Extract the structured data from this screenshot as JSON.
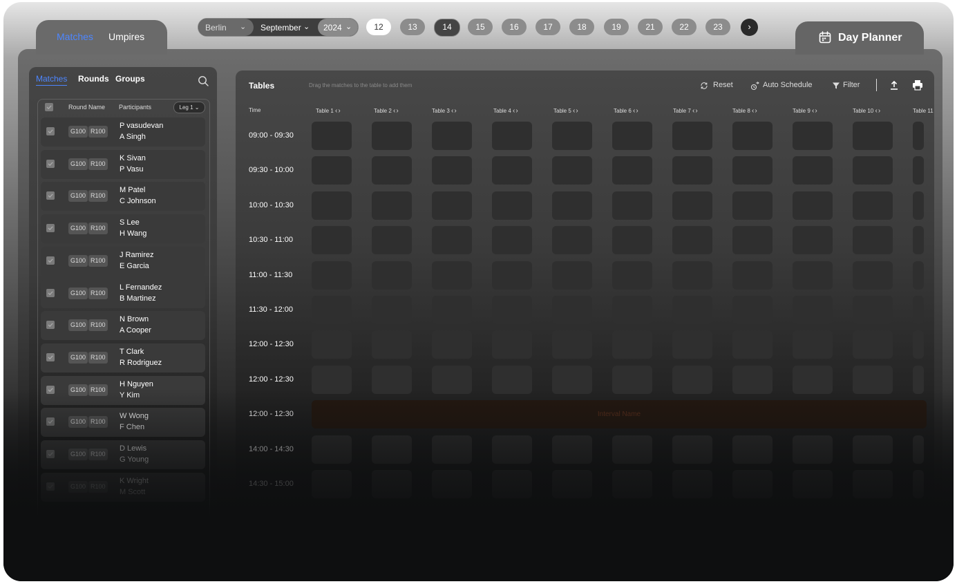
{
  "top_tabs": {
    "matches": "Matches",
    "umpires": "Umpires"
  },
  "day_planner": {
    "title": "Day Planner",
    "icon": "calendar-icon"
  },
  "date_selector": {
    "city": "Berlin",
    "month": "September",
    "year": "2024"
  },
  "dates": [
    "12",
    "13",
    "14",
    "15",
    "16",
    "17",
    "18",
    "19",
    "21",
    "22",
    "23"
  ],
  "selected_date": "12",
  "current_date": "14",
  "accent_color": "#4d86ff",
  "sidebar": {
    "tabs": [
      "Matches",
      "Rounds",
      "Groups"
    ],
    "active_tab": "Matches",
    "list_header": {
      "round": "Round Name",
      "participants": "Participants",
      "leg": "Leg 1"
    },
    "matches": [
      {
        "group": "G100",
        "round": "R100",
        "p1": "P vasudevan",
        "p2": "A Singh"
      },
      {
        "group": "G100",
        "round": "R100",
        "p1": "K Sivan",
        "p2": "P Vasu"
      },
      {
        "group": "G100",
        "round": "R100",
        "p1": "M Patel",
        "p2": "C Johnson"
      },
      {
        "group": "G100",
        "round": "R100",
        "p1": "S Lee",
        "p2": "H Wang"
      },
      {
        "group": "G100",
        "round": "R100",
        "p1": "J Ramirez",
        "p2": "E Garcia"
      },
      {
        "group": "G100",
        "round": "R100",
        "p1": "L Fernandez",
        "p2": "B Martinez"
      },
      {
        "group": "G100",
        "round": "R100",
        "p1": "N Brown",
        "p2": "A Cooper"
      },
      {
        "group": "G100",
        "round": "R100",
        "p1": "T Clark",
        "p2": "R Rodriguez"
      },
      {
        "group": "G100",
        "round": "R100",
        "p1": "H Nguyen",
        "p2": "Y Kim"
      },
      {
        "group": "G100",
        "round": "R100",
        "p1": "W Wong",
        "p2": "F Chen"
      },
      {
        "group": "G100",
        "round": "R100",
        "p1": "D Lewis",
        "p2": "G Young"
      },
      {
        "group": "G100",
        "round": "R100",
        "p1": "K Wright",
        "p2": "M Scott"
      }
    ]
  },
  "tables_panel": {
    "title": "Tables",
    "hint": "Drag the matches to the table to add them",
    "reset": "Reset",
    "auto_schedule": "Auto Schedule",
    "filter": "Filter",
    "time_label": "Time",
    "tables": [
      "Table 1",
      "Table 2",
      "Table 3",
      "Table 4",
      "Table 5",
      "Table 6",
      "Table 7",
      "Table 8",
      "Table 9",
      "Table 10",
      "Table 11"
    ],
    "time_slots": [
      "09:00 - 09:30",
      "09:30 - 10:00",
      "10:00 - 10:30",
      "10:30 - 11:00",
      "11:00 - 11:30",
      "11:30 - 12:00",
      "12:00 - 12:30",
      "12:00 - 12:30",
      "12:00 - 12:30",
      "14:00 - 14:30",
      "14:30 - 15:00"
    ],
    "interval_label": "Interval Name"
  }
}
